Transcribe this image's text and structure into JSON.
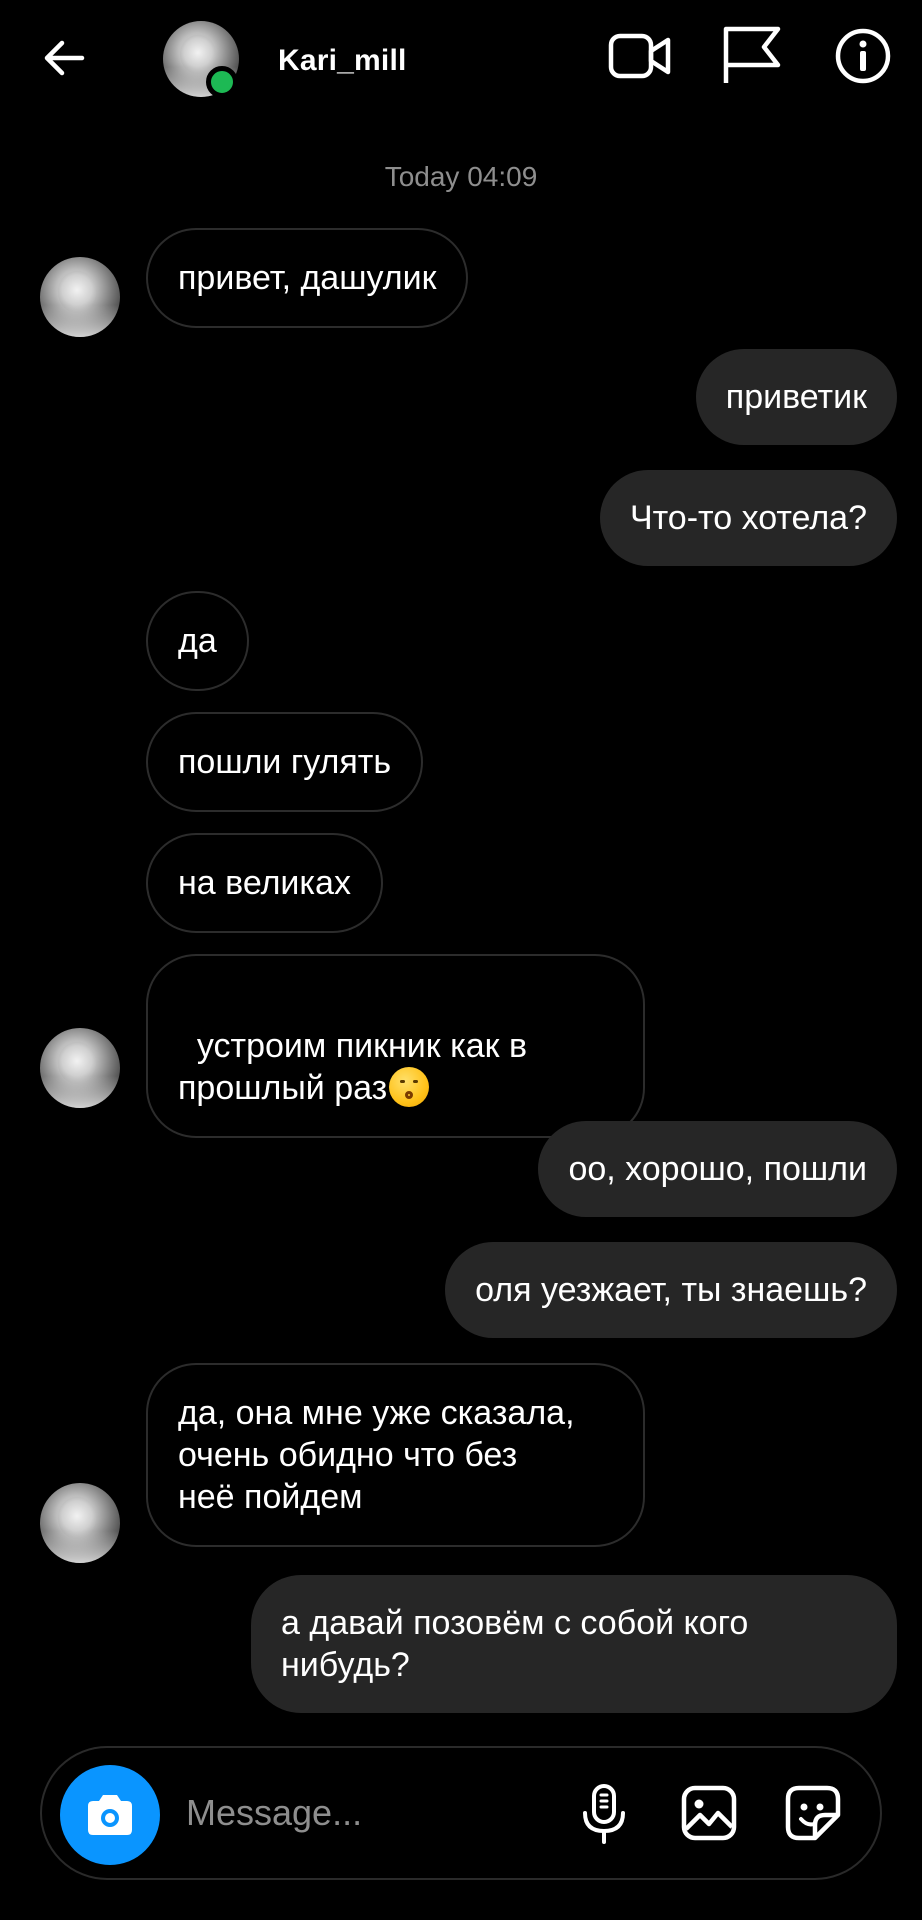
{
  "header": {
    "back_icon": "arrow-left-icon",
    "username": "Kari_mill",
    "online": true,
    "video_icon": "video-camera-icon",
    "flag_icon": "flag-icon",
    "info_icon": "info-icon"
  },
  "timestamp": "Today 04:09",
  "messages": [
    {
      "dir": "in",
      "text": "привет, дашулик"
    },
    {
      "dir": "out",
      "text": "приветик"
    },
    {
      "dir": "out",
      "text": "Что-то хотела?"
    },
    {
      "dir": "in",
      "text": "да"
    },
    {
      "dir": "in",
      "text": "пошли гулять"
    },
    {
      "dir": "in",
      "text": "на великах"
    },
    {
      "dir": "in",
      "text": "устроим пикник как в\nпрошлый раз",
      "emoji": "kissing-face-emoji"
    },
    {
      "dir": "out",
      "text": "оо, хорошо, пошли"
    },
    {
      "dir": "out",
      "text": "оля уезжает, ты знаешь?"
    },
    {
      "dir": "in",
      "text": "да, она мне уже сказала,\nочень обидно что без\nнеё пойдем"
    },
    {
      "dir": "out",
      "text": "а давай позовём с собой кого\nнибудь?"
    }
  ],
  "composer": {
    "placeholder": "Message...",
    "camera_icon": "camera-icon",
    "mic_icon": "microphone-icon",
    "gallery_icon": "gallery-icon",
    "sticker_icon": "sticker-icon"
  },
  "colors": {
    "background": "#000000",
    "outgoing_bubble": "#262626",
    "incoming_border": "#2c2c2c",
    "accent_blue": "#0a95ff",
    "online_green": "#1db954",
    "muted_text": "#8e8e8e"
  }
}
